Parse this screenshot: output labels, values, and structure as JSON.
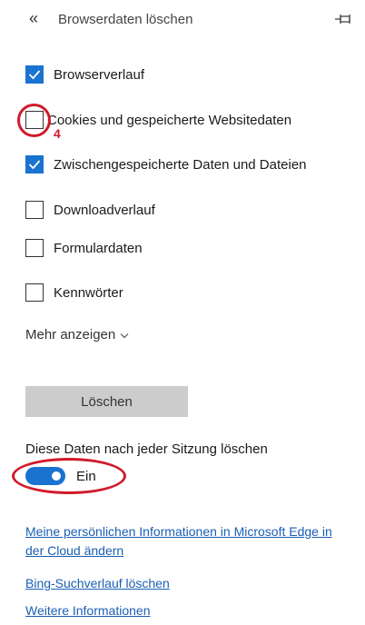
{
  "header": {
    "back_glyph": "«",
    "title": "Browserdaten löschen",
    "pin_icon": "pin-icon"
  },
  "options": [
    {
      "label": "Browserverlauf",
      "checked": true
    },
    {
      "label": "Cookies und gespeicherte Websitedaten",
      "checked": false
    },
    {
      "label": "Zwischengespeicherte Daten und Dateien",
      "checked": true
    },
    {
      "label": "Downloadverlauf",
      "checked": false
    },
    {
      "label": "Formulardaten",
      "checked": false
    },
    {
      "label": "Kennwörter",
      "checked": false
    }
  ],
  "more": {
    "label": "Mehr anzeigen",
    "icon": "chevron-down-icon"
  },
  "clear_button": {
    "label": "Löschen"
  },
  "session": {
    "label": "Diese Daten nach jeder Sitzung löschen",
    "toggle_label": "Ein",
    "toggle_on": true
  },
  "links": {
    "cloud_info": "Meine persönlichen Informationen in Microsoft Edge in der Cloud ändern",
    "bing_history": "Bing-Suchverlauf löschen",
    "more_info": "Weitere Informationen"
  },
  "annotations": {
    "step_number": "4",
    "color": "#d11a2a"
  },
  "colors": {
    "accent": "#1a73d1",
    "link": "#1a5fb4",
    "button_bg": "#cccccc"
  }
}
